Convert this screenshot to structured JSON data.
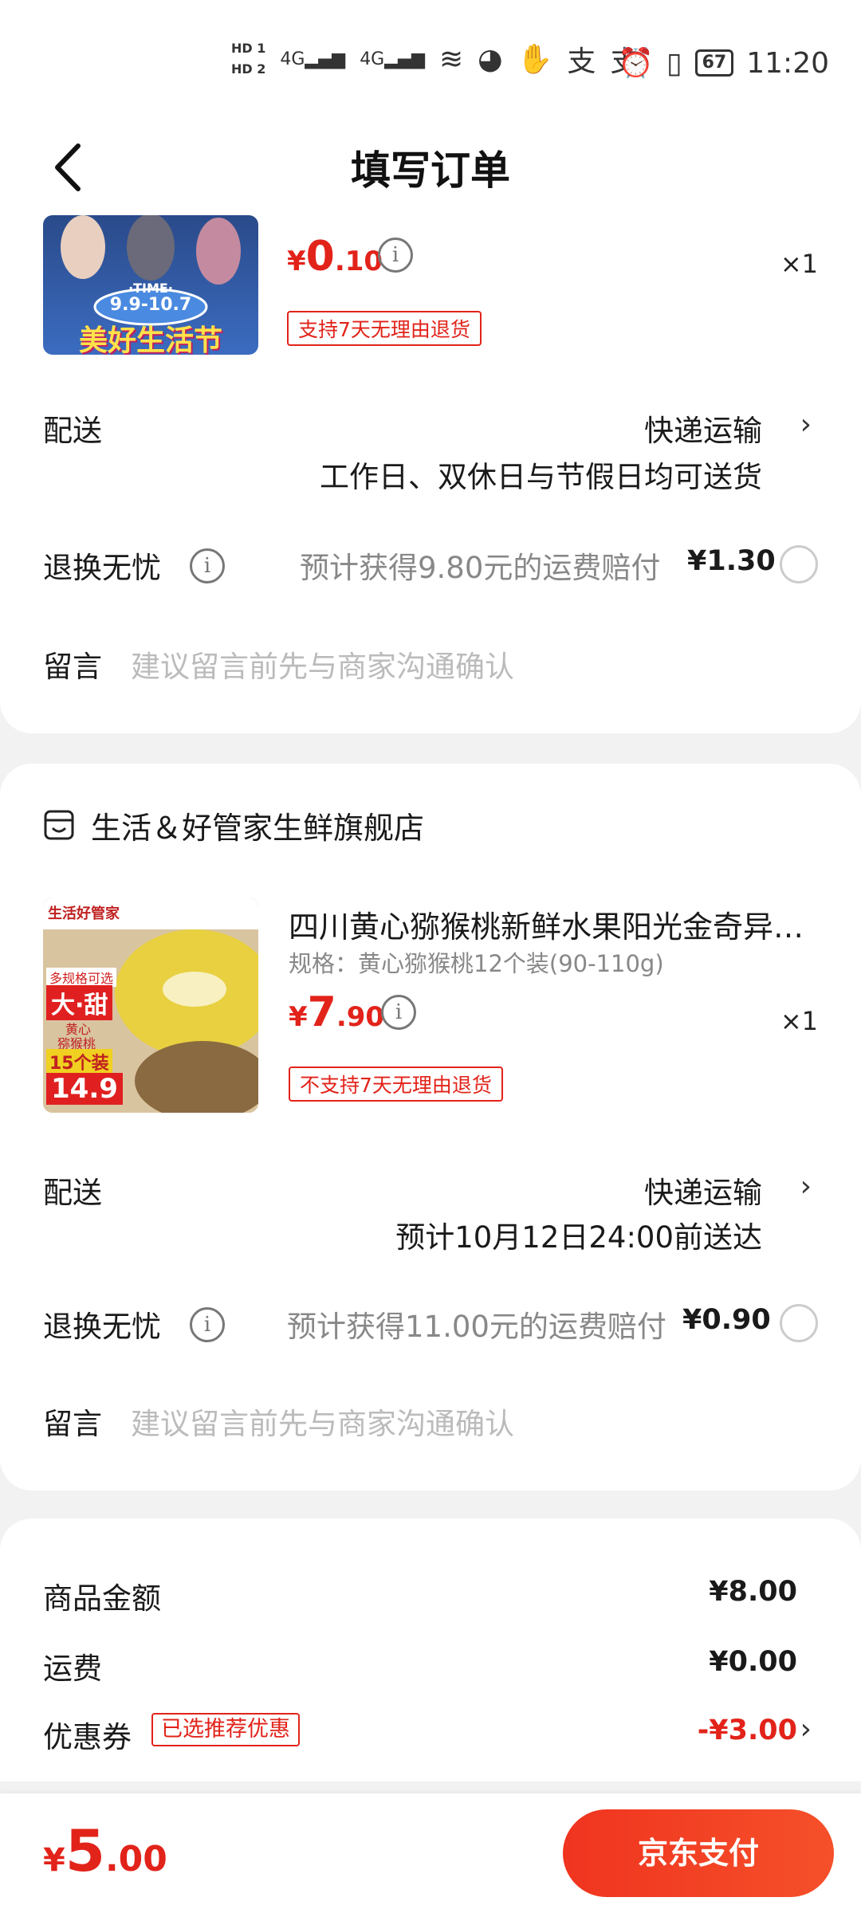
{
  "status_bar": {
    "hd1": "HD 1",
    "hd2": "HD 2",
    "net1": "4G",
    "net2": "4G",
    "alipay1": "支",
    "alipay2": "支",
    "battery": "67",
    "time": "11:20"
  },
  "header": {
    "title": "填写订单"
  },
  "order1": {
    "banner_time": "·TIME·",
    "banner_dates": "9.9-10.7",
    "banner_text": "美好生活节",
    "price_currency": "¥",
    "price_int": "0",
    "price_dec": ".10",
    "quantity": "×1",
    "return_tag": "支持7天无理由退货",
    "delivery_label": "配送",
    "delivery_method": "快递运输",
    "delivery_note": "工作日、双休日与节假日均可送货",
    "return_worry_label": "退换无忧",
    "compensation_text": "预计获得9.80元的运费赔付",
    "compensation_amount": "¥1.30",
    "message_label": "留言",
    "message_placeholder": "建议留言前先与商家沟通确认"
  },
  "order2": {
    "store_name": "生活＆好管家生鲜旗舰店",
    "product_title": "四川黄心猕猴桃新鲜水果阳光金奇异…",
    "product_spec": "规格：黄心猕猴桃12个装(90-110g)",
    "img_brand": "生活好管家",
    "img_badge": "多规格可选",
    "img_big": "大·甜",
    "img_sub1": "黄心",
    "img_sub2": "猕猴桃",
    "img_count": "15个装",
    "img_price": "14.9",
    "price_currency": "¥",
    "price_int": "7",
    "price_dec": ".90",
    "quantity": "×1",
    "return_tag": "不支持7天无理由退货",
    "delivery_label": "配送",
    "delivery_method": "快递运输",
    "delivery_note": "预计10月12日24:00前送达",
    "return_worry_label": "退换无忧",
    "compensation_text": "预计获得11.00元的运费赔付",
    "compensation_amount": "¥0.90",
    "message_label": "留言",
    "message_placeholder": "建议留言前先与商家沟通确认"
  },
  "summary": {
    "goods_label": "商品金额",
    "goods_value": "¥8.00",
    "shipping_label": "运费",
    "shipping_value": "¥0.00",
    "coupon_label": "优惠券",
    "coupon_tag": "已选推荐优惠",
    "coupon_value": "-¥3.00"
  },
  "bottom_bar": {
    "total_currency": "¥",
    "total_int": "5",
    "total_dec": ".00",
    "pay_button": "京东支付"
  },
  "colors": {
    "accent": "#e2231a",
    "background": "#f2f2f2"
  }
}
